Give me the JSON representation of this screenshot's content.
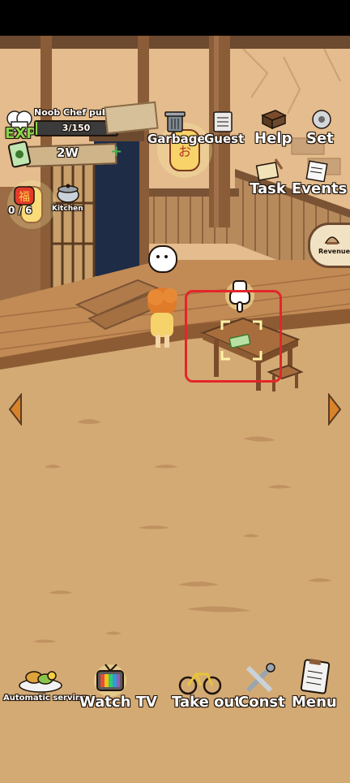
{
  "pub": {
    "name": "Noob Chef pub",
    "exp_label": "EXP",
    "exp_value": "3/150",
    "exp_progress": 0.02
  },
  "money": {
    "amount": "2W",
    "add_symbol": "+"
  },
  "guests": {
    "count": "0 / 6"
  },
  "kitchen": {
    "label": "Kitchen"
  },
  "top_menu": {
    "garbage": "Garbage",
    "guest": "Guest",
    "help": "Help",
    "set": "Set",
    "task": "Task",
    "events": "Events",
    "revenue": "Revenue"
  },
  "bottom_menu": {
    "auto_serving": "Automatic serving",
    "watch_tv": "Watch TV",
    "take_out": "Take out",
    "const": "Const",
    "menu": "Menu"
  },
  "colors": {
    "highlight_red": "#e3262a",
    "money_green": "#4caf50",
    "floor": "#d9b07a",
    "wall": "#e2b98a"
  }
}
